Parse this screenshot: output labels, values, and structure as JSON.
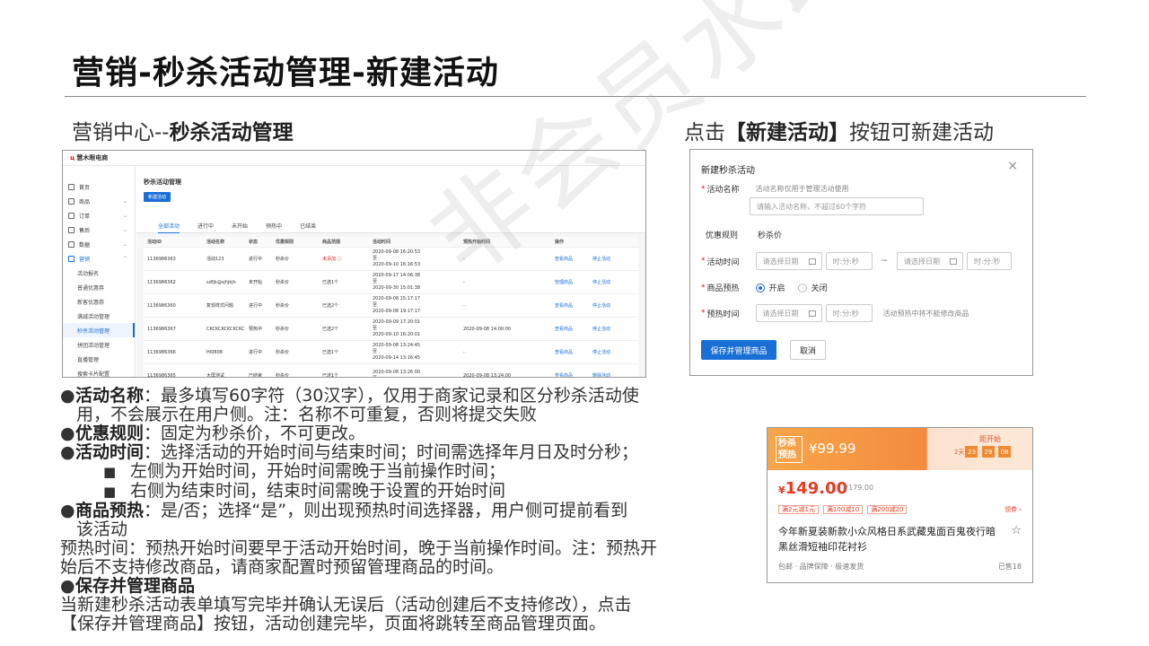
{
  "page": {
    "title": "营销-秒杀活动管理-新建活动",
    "section_left_prefix": "营销中心--",
    "section_left_bold": "秒杀活动管理",
    "section_right_prefix": "点击",
    "section_right_bold": "【新建活动】",
    "section_right_suffix": "按钮可新建活动",
    "watermark": "非会员水印"
  },
  "admin": {
    "logo_mark": "ц",
    "logo_text": "慧木眼电商",
    "menu": [
      {
        "label": "首页",
        "icon": "home-icon",
        "chev": ""
      },
      {
        "label": "商品",
        "icon": "goods-icon",
        "chev": "⌄"
      },
      {
        "label": "订单",
        "icon": "order-icon",
        "chev": "⌄"
      },
      {
        "label": "售后",
        "icon": "aftersale-icon",
        "chev": "⌄"
      },
      {
        "label": "数据",
        "icon": "chart-icon",
        "chev": "⌄"
      },
      {
        "label": "营销",
        "icon": "marketing-icon",
        "chev": "⌃"
      }
    ],
    "submenu": [
      "活动报名",
      "普通优惠券",
      "新客优惠券",
      "满减活动管理",
      "秒杀活动管理",
      "拼团活动管理",
      "直播管理",
      "搜索卡片配置"
    ],
    "page_title": "秒杀活动管理",
    "new_button": "新建活动",
    "tabs": [
      "全部活动",
      "进行中",
      "未开始",
      "预热中",
      "已结束"
    ],
    "columns": [
      "活动ID",
      "活动名称",
      "状态",
      "优惠规则",
      "商品范围",
      "活动时间",
      "预热开始时间",
      "操作",
      ""
    ],
    "rows": [
      {
        "id": "1136986363",
        "name": "活动123",
        "status": "进行中",
        "rule": "秒杀价",
        "scope": "未添加 ⓘ",
        "time1": "2020-09-08 16:20:53",
        "time_mid": "至",
        "time2": "2020-09-10 16:16:53",
        "preheat": "-",
        "op1": "查看商品",
        "op2": "停止活动"
      },
      {
        "id": "1136986362",
        "name": "sdfjk@sjhjkjh",
        "status": "未开始",
        "rule": "秒杀价",
        "scope": "已选1个",
        "time1": "2020-09-17 14:06:38",
        "time_mid": "至",
        "time2": "2020-09-30 15:01:38",
        "preheat": "-",
        "op1": "管理商品",
        "op2": "停止活动"
      },
      {
        "id": "1136986360",
        "name": "复现样式问题",
        "status": "进行中",
        "rule": "秒杀价",
        "scope": "已选2个",
        "time1": "2020-09-08 15:17:17",
        "time_mid": "至",
        "time2": "2020-09-08 19:17:17",
        "preheat": "-",
        "op1": "查看商品",
        "op2": "停止活动"
      },
      {
        "id": "1136986367",
        "name": "CKCKCKCKCKCKCKCKCKCKCKCKCKCKCKCKCKCKCKCK...",
        "status": "预热中",
        "rule": "秒杀价",
        "scope": "已选2个",
        "time1": "2020-09-09 17:20:01",
        "time_mid": "至",
        "time2": "2020-09-10 16:20:01",
        "preheat": "2020-09-08 14:00:00",
        "op1": "查看商品",
        "op2": "停止活动"
      },
      {
        "id": "1136986366",
        "name": "HI0808",
        "status": "进行中",
        "rule": "秒杀价",
        "scope": "已选1个",
        "time1": "2020-09-08 13:24:45",
        "time_mid": "至",
        "time2": "2020-09-14 13:16:45",
        "preheat": "-",
        "op1": "查看商品",
        "op2": "停止活动"
      },
      {
        "id": "1136986365",
        "name": "大屏测试",
        "status": "已结束",
        "rule": "秒杀价",
        "scope": "已选1个",
        "time1": "2020-09-08 13:26:00",
        "time_mid": "至",
        "time2": "",
        "preheat": "2020-09-08 13:24:00",
        "op1": "查看商品",
        "op2": "删除活动"
      }
    ]
  },
  "dialog": {
    "title": "新建秒杀活动",
    "close": "×",
    "name_label": "活动名称",
    "name_hint": "活动名称仅用于管理活动使用",
    "name_placeholder": "请输入活动名称，不超过60个字符",
    "rule_label": "优惠规则",
    "rule_value": "秒杀价",
    "time_label": "活动时间",
    "date_placeholder": "请选择日期",
    "time_placeholder": "时:分:秒",
    "tilde": "~",
    "preheat_label": "商品预热",
    "opt_on": "开启",
    "opt_off": "关闭",
    "preheat_time_label": "预热时间",
    "preheat_hint": "活动预热中将不能修改商品",
    "save_button": "保存并管理商品",
    "cancel_button": "取消"
  },
  "body": {
    "bullet": "●",
    "square": "■",
    "p1_bold": "活动名称",
    "p1_text": "：最多填写60字符（30汉字），仅用于商家记录和区分秒杀活动使",
    "p1_cont": "用，不会展示在用户侧。注：名称不可重复，否则将提交失败",
    "p2_bold": "优惠规则",
    "p2_text": "：固定为秒杀价，不可更改。",
    "p3_bold": "活动时间",
    "p3_text": "：选择活动的开始时间与结束时间；时间需选择年月日及时分秒；",
    "p3_sub1": "左侧为开始时间，开始时间需晚于当前操作时间；",
    "p3_sub2": "右侧为结束时间，结束时间需晚于设置的开始时间",
    "p4_bold": "商品预热",
    "p4_text": "：是/否；选择“是”，则出现预热时间选择器，用户侧可提前看到",
    "p4_cont": "该活动",
    "p5_line1": "预热时间：预热开始时间要早于活动开始时间，晚于当前操作时间。注：预热开",
    "p5_line2": "始后不支持修改商品，请商家配置时预留管理商品的时间。",
    "p6_bold": "保存并管理商品",
    "p7_line1": "当新建秒杀活动表单填写完毕并确认无误后（活动创建后不支持修改），点击",
    "p7_line2": "【保存并管理商品】按钮，活动创建完毕，页面将跳转至商品管理页面。"
  },
  "product": {
    "badge": "秒杀预热",
    "preheat_price": "¥99.99",
    "countdown_label": "距开始",
    "countdown_day": "2天",
    "countdown": [
      "23",
      "29",
      "08"
    ],
    "price_symbol": "¥",
    "price": "149.00",
    "orig_price": "¥179.00",
    "coupons": [
      "满2元减1元",
      "满100减10",
      "满200减20"
    ],
    "coupon_more": "领券 ›",
    "name": "今年新夏装新款小众风格日系武藏鬼面百鬼夜行暗黑丝滑短袖印花衬衫",
    "star": "☆",
    "meta": "包邮 · 品牌保障 · 极速发货",
    "sold": "已售18"
  }
}
